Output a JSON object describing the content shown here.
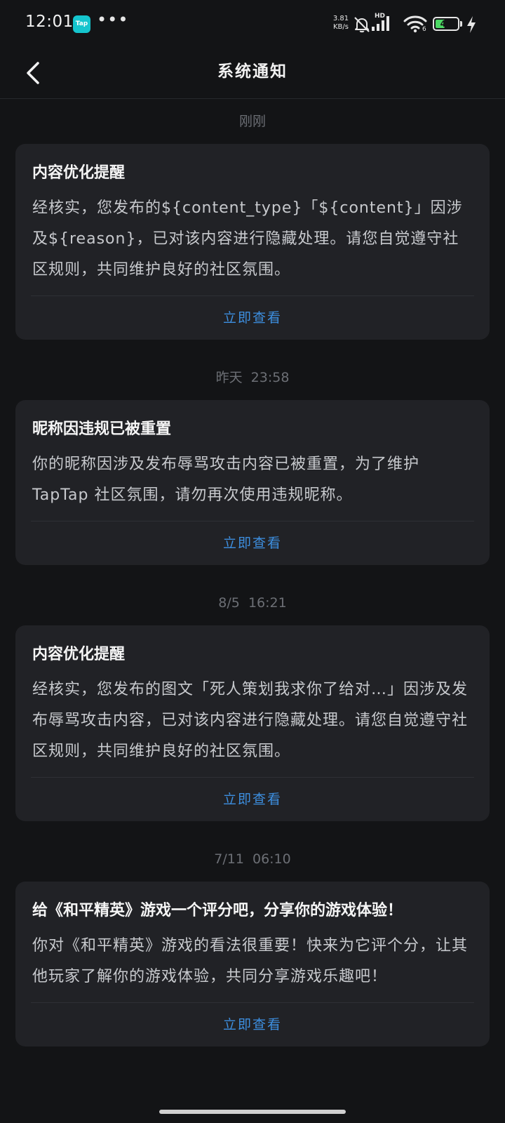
{
  "status_bar": {
    "time": "12:01",
    "app_icon_label": "Tap",
    "more": "•••",
    "net_speed_value": "3.81",
    "net_speed_unit": "KB/s",
    "signal_label": "HD",
    "wifi_label": "6",
    "battery_level": 43,
    "battery_text": "43",
    "icons": [
      "tap-app-icon",
      "mute-bell-icon",
      "hd-signal-icon",
      "wifi-icon",
      "battery-icon",
      "charging-bolt-icon"
    ]
  },
  "header": {
    "back_icon": "chevron-left-icon",
    "title": "系统通知"
  },
  "notices": [
    {
      "timestamp": "刚刚",
      "title": "内容优化提醒",
      "body": "经核实，您发布的${content_type}「${content}」因涉及${reason}，已对该内容进行隐藏处理。请您自觉遵守社区规则，共同维护良好的社区氛围。",
      "action": "立即查看"
    },
    {
      "timestamp": "昨天  23:58",
      "title": "昵称因违规已被重置",
      "body": "你的昵称因涉及发布辱骂攻击内容已被重置，为了维护 TapTap 社区氛围，请勿再次使用违规昵称。",
      "action": "立即查看"
    },
    {
      "timestamp": "8/5  16:21",
      "title": "内容优化提醒",
      "body": "经核实，您发布的图文「死人策划我求你了给对…」因涉及发布辱骂攻击内容，已对该内容进行隐藏处理。请您自觉遵守社区规则，共同维护良好的社区氛围。",
      "action": "立即查看"
    },
    {
      "timestamp": "7/11  06:10",
      "title": "给《和平精英》游戏一个评分吧，分享你的游戏体验！",
      "body": "你对《和平精英》游戏的看法很重要！快来为它评个分，让其他玩家了解你的游戏体验，共同分享游戏乐趣吧！",
      "action": "立即查看"
    }
  ],
  "colors": {
    "background": "#131416",
    "card": "#212226",
    "accent_link": "#3d8fe0",
    "timestamp": "#6c6f75",
    "tap_brand": "#15c5ce",
    "battery_fill": "#4cd964"
  }
}
